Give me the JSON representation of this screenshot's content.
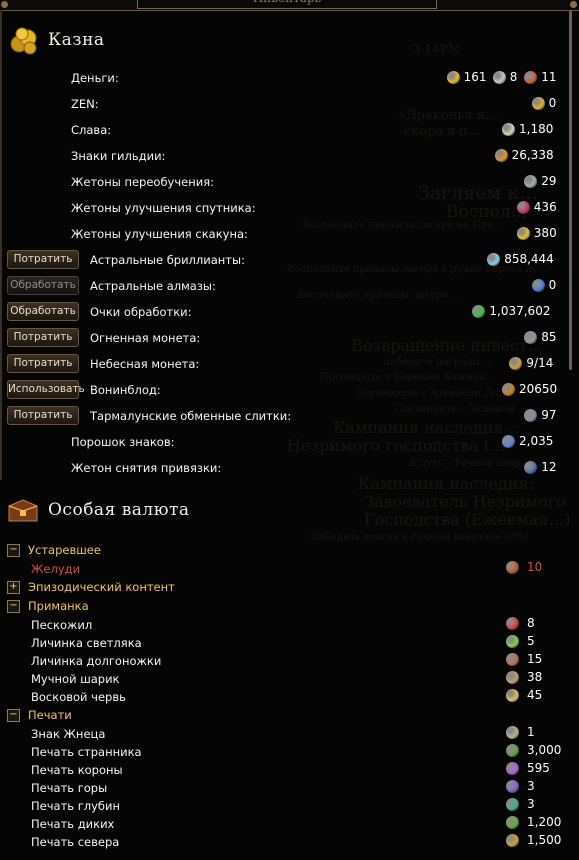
{
  "window": {
    "title": "Инвентарь"
  },
  "background": {
    "lines": [
      "3:14PM",
      "«Драконья я…",
      "скоро в п…",
      "Загляем к…",
      "Воспол…",
      "Восполните припасы лагеря на Про…",
      "Восполните припасы лагеря в руине Берега Ж…",
      "Восполните припасы лагеря…",
      "Возвращение инвест…",
      "Заберите награды…",
      "Поговорите с Бериком Каммен…",
      "Поговорите с Атенасом Л…",
      "Поговорите с Эсленом",
      "Кампания наследия…",
      "Незримого господства (…",
      "В путь – Речной квар…",
      "Кампания наследия:",
      "Завоеватель Незримого",
      "Господства (Ежеемая…)",
      "Победить врагов в Речном квартале (0%)"
    ]
  },
  "treasury": {
    "title": "Казна",
    "rows": [
      {
        "label": "Деньги:",
        "button": "",
        "values": [
          {
            "icon": "gold-coin-icon",
            "color": "#e8b820",
            "value": "161"
          },
          {
            "icon": "silver-coin-icon",
            "color": "#c8c8c8",
            "value": "8"
          },
          {
            "icon": "copper-coin-icon",
            "color": "#d0603a",
            "value": "11"
          }
        ]
      },
      {
        "label": "ZEN:",
        "button": "",
        "values": [
          {
            "icon": "zen-icon",
            "color": "#e0b030",
            "value": "0"
          }
        ]
      },
      {
        "label": "Слава:",
        "button": "",
        "values": [
          {
            "icon": "glory-icon",
            "color": "#d8d0b0",
            "value": "1,180"
          }
        ]
      },
      {
        "label": "Знаки гильдии:",
        "button": "",
        "values": [
          {
            "icon": "guild-mark-icon",
            "color": "#e09a20",
            "value": "26,338"
          }
        ]
      },
      {
        "label": "Жетоны переобучения:",
        "button": "",
        "values": [
          {
            "icon": "retraining-token-icon",
            "color": "#9fb0a0",
            "value": "29"
          }
        ]
      },
      {
        "label": "Жетоны улучшения спутника:",
        "button": "",
        "values": [
          {
            "icon": "companion-token-icon",
            "color": "#c8306a",
            "value": "436"
          }
        ]
      },
      {
        "label": "Жетоны улучшения скакуна:",
        "button": "",
        "values": [
          {
            "icon": "mount-token-icon",
            "color": "#e8c030",
            "value": "380"
          }
        ]
      },
      {
        "label": "Астральные бриллианты:",
        "button": "Потратить",
        "disabled": false,
        "values": [
          {
            "icon": "astral-diamond-icon",
            "color": "#7fd0f0",
            "value": "858,444"
          }
        ]
      },
      {
        "label": "Астральные алмазы:",
        "button": "Обработать",
        "disabled": true,
        "values": [
          {
            "icon": "rough-diamond-icon",
            "color": "#5080d0",
            "value": "0"
          }
        ]
      },
      {
        "label": "Очки обработки:",
        "button": "Обработать",
        "disabled": false,
        "values": [
          {
            "icon": "refinement-point-icon",
            "color": "#40c040",
            "value": "1,037,602"
          }
        ]
      },
      {
        "label": "Огненная монета:",
        "button": "Потратить",
        "disabled": false,
        "values": [
          {
            "icon": "fire-coin-icon",
            "color": "#9098a8",
            "value": "85"
          }
        ]
      },
      {
        "label": "Небесная монета:",
        "button": "Потратить",
        "disabled": false,
        "values": [
          {
            "icon": "celestial-coin-icon",
            "color": "#d0a040",
            "value": "9/14"
          }
        ]
      },
      {
        "label": "Вонинблод:",
        "button": "Использовать",
        "disabled": false,
        "values": [
          {
            "icon": "voninblood-icon",
            "color": "#d08020",
            "value": "20650"
          }
        ]
      },
      {
        "label": "Тармалунские обменные слитки:",
        "button": "Потратить",
        "disabled": false,
        "values": [
          {
            "icon": "trade-bar-icon",
            "color": "#8090a0",
            "value": "97"
          }
        ]
      },
      {
        "label": "Порошок знаков:",
        "button": "",
        "values": [
          {
            "icon": "enchant-powder-icon",
            "color": "#6080e0",
            "value": "2,035"
          }
        ]
      },
      {
        "label": "Жетон снятия привязки:",
        "button": "",
        "values": [
          {
            "icon": "unbind-token-icon",
            "color": "#5070b0",
            "value": "12"
          }
        ]
      }
    ]
  },
  "special": {
    "title": "Особая валюта",
    "categories": [
      {
        "toggle": "−",
        "label": "Устаревшее",
        "items": [
          {
            "label": "Желуди",
            "red": true,
            "icon": "acorn-icon",
            "color": "#c05830",
            "value": "10"
          }
        ]
      },
      {
        "toggle": "+",
        "label": "Эпизодический контент",
        "items": []
      },
      {
        "toggle": "−",
        "label": "Приманка",
        "items": [
          {
            "label": "Пескожил",
            "icon": "sandworm-icon",
            "color": "#d04040",
            "value": "8"
          },
          {
            "label": "Личинка светляка",
            "icon": "glowworm-icon",
            "color": "#80d040",
            "value": "5"
          },
          {
            "label": "Личинка долгоножки",
            "icon": "grub-icon",
            "color": "#c07050",
            "value": "15"
          },
          {
            "label": "Мучной шарик",
            "icon": "doughball-icon",
            "color": "#c0a070",
            "value": "38"
          },
          {
            "label": "Восковой червь",
            "icon": "waxworm-icon",
            "color": "#e0c060",
            "value": "45"
          }
        ]
      },
      {
        "toggle": "−",
        "label": "Печати",
        "items": [
          {
            "label": "Знак Жнеца",
            "icon": "reaper-mark-icon",
            "color": "#c0b090",
            "value": "1"
          },
          {
            "label": "Печать странника",
            "icon": "wanderer-seal-icon",
            "color": "#60a040",
            "value": "3,000"
          },
          {
            "label": "Печать короны",
            "icon": "crown-seal-icon",
            "color": "#b060e0",
            "value": "595"
          },
          {
            "label": "Печать горы",
            "icon": "mountain-seal-icon",
            "color": "#8060d0",
            "value": "3"
          },
          {
            "label": "Печать глубин",
            "icon": "depths-seal-icon",
            "color": "#40b090",
            "value": "3"
          },
          {
            "label": "Печать диких",
            "icon": "wild-seal-icon",
            "color": "#60b040",
            "value": "1,200"
          },
          {
            "label": "Печать севера",
            "icon": "north-seal-icon",
            "color": "#d0a030",
            "value": "1,500"
          }
        ]
      }
    ]
  }
}
